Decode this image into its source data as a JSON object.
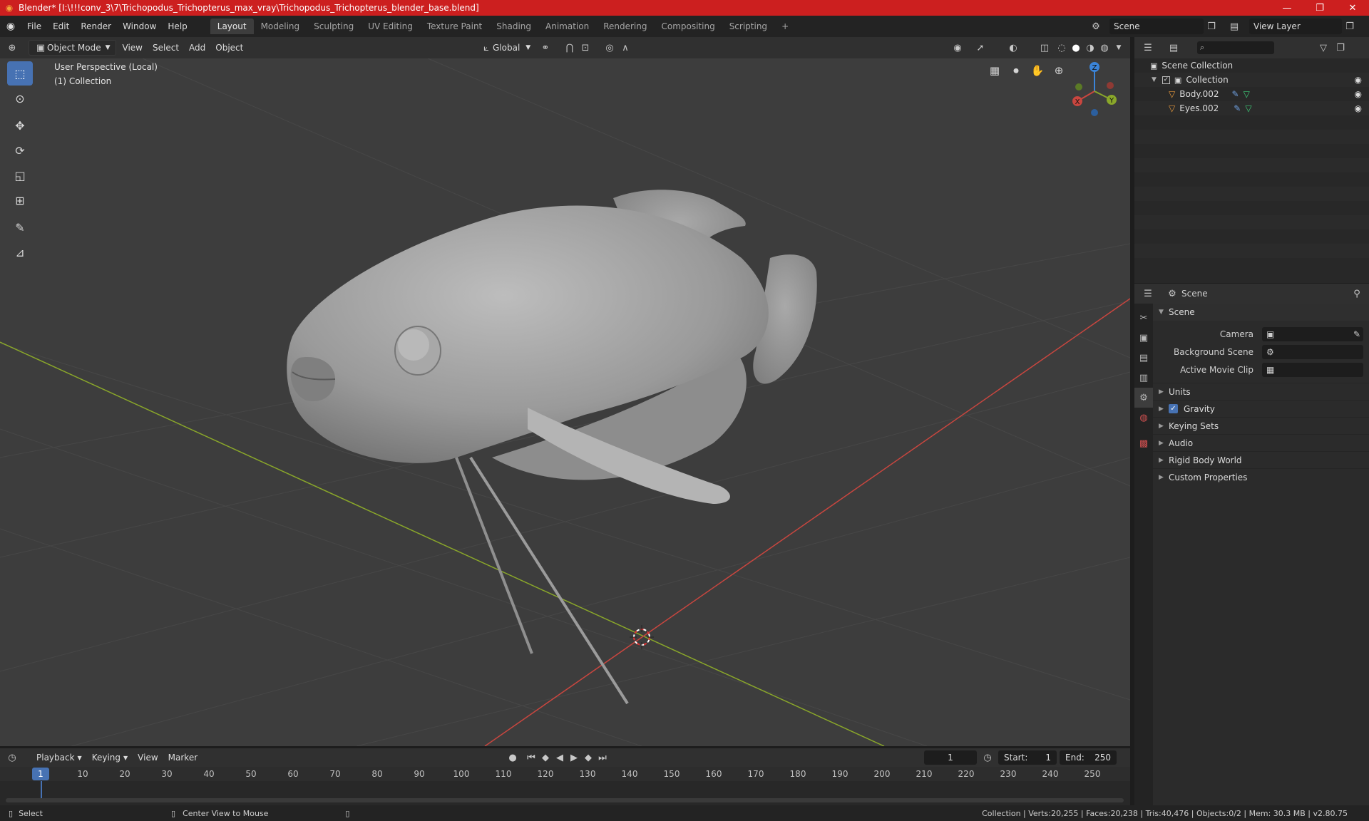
{
  "window": {
    "title": "Blender* [I:\\!!!conv_3\\7\\Trichopodus_Trichopterus_max_vray\\Trichopodus_Trichopterus_blender_base.blend]",
    "controls": [
      "—",
      "❐",
      "✕"
    ]
  },
  "menu": [
    "File",
    "Edit",
    "Render",
    "Window",
    "Help"
  ],
  "workspaces": [
    "Layout",
    "Modeling",
    "Sculpting",
    "UV Editing",
    "Texture Paint",
    "Shading",
    "Animation",
    "Rendering",
    "Compositing",
    "Scripting"
  ],
  "workspace_add": "+",
  "scene_field": "Scene",
  "view_layer_field": "View Layer",
  "viewport_header": {
    "mode": "Object Mode",
    "menus": [
      "View",
      "Select",
      "Add",
      "Object"
    ],
    "transform_orientation": "Global"
  },
  "viewport": {
    "perspective_label": "User Perspective (Local)",
    "collection_label": "(1) Collection",
    "gizmo": {
      "x": "X",
      "y": "Y",
      "z": "Z"
    },
    "colors": {
      "x_axis": "#c9463f",
      "y_axis": "#8aa72a",
      "z_axis": "#3b84d8",
      "background": "#3d3d3d"
    }
  },
  "outliner": {
    "items": [
      {
        "label": "Scene Collection"
      },
      {
        "label": "Collection"
      },
      {
        "label": "Body.002"
      },
      {
        "label": "Eyes.002"
      }
    ]
  },
  "properties": {
    "header_label": "Scene",
    "panel_title": "Scene",
    "rows": [
      {
        "label": "Camera"
      },
      {
        "label": "Background Scene"
      },
      {
        "label": "Active Movie Clip"
      }
    ],
    "sub_panels": [
      "Units",
      "Gravity",
      "Keying Sets",
      "Audio",
      "Rigid Body World",
      "Custom Properties"
    ]
  },
  "timeline": {
    "menus": [
      "Playback",
      "Keying",
      "View",
      "Marker"
    ],
    "current_frame": "1",
    "start_label": "Start:",
    "start_value": "1",
    "end_label": "End:",
    "end_value": "250",
    "ruler_ticks": [
      "1",
      "10",
      "20",
      "30",
      "40",
      "50",
      "60",
      "70",
      "80",
      "90",
      "100",
      "110",
      "120",
      "130",
      "140",
      "150",
      "160",
      "170",
      "180",
      "190",
      "200",
      "210",
      "220",
      "230",
      "240",
      "250"
    ],
    "accent": "#4772b3"
  },
  "status": {
    "left_action": "Select",
    "middle_action": "Center View to Mouse",
    "stats": "Collection | Verts:20,255 | Faces:20,238 | Tris:40,476 | Objects:0/2 | Mem: 30.3 MB | v2.80.75"
  }
}
